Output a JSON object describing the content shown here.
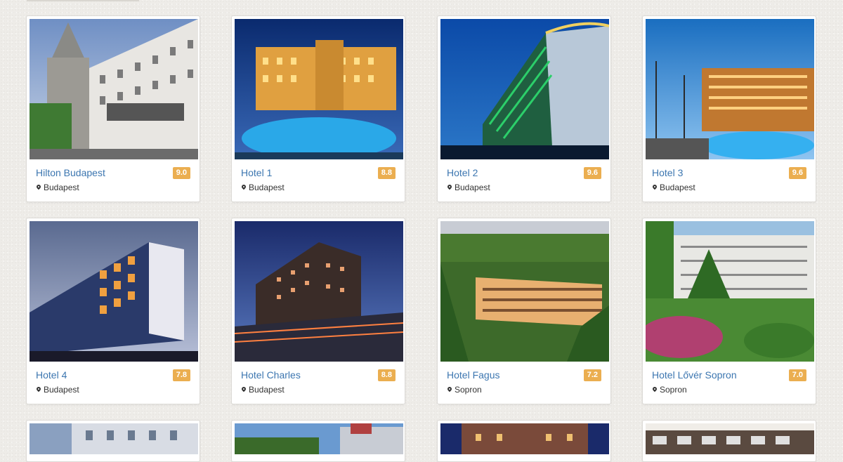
{
  "hotels": [
    {
      "name": "Hilton Budapest",
      "rating": "9.0",
      "city": "Budapest"
    },
    {
      "name": "Hotel 1",
      "rating": "8.8",
      "city": "Budapest"
    },
    {
      "name": "Hotel 2",
      "rating": "9.6",
      "city": "Budapest"
    },
    {
      "name": "Hotel 3",
      "rating": "9.6",
      "city": "Budapest"
    },
    {
      "name": "Hotel 4",
      "rating": "7.8",
      "city": "Budapest"
    },
    {
      "name": "Hotel Charles",
      "rating": "8.8",
      "city": "Budapest"
    },
    {
      "name": "Hotel Fagus",
      "rating": "7.2",
      "city": "Sopron"
    },
    {
      "name": "Hotel Lővér Sopron",
      "rating": "7.0",
      "city": "Sopron"
    }
  ],
  "colors": {
    "link": "#3c76b0",
    "rating_badge": "#ebae50"
  },
  "icons": {
    "location": "map-marker-icon"
  }
}
